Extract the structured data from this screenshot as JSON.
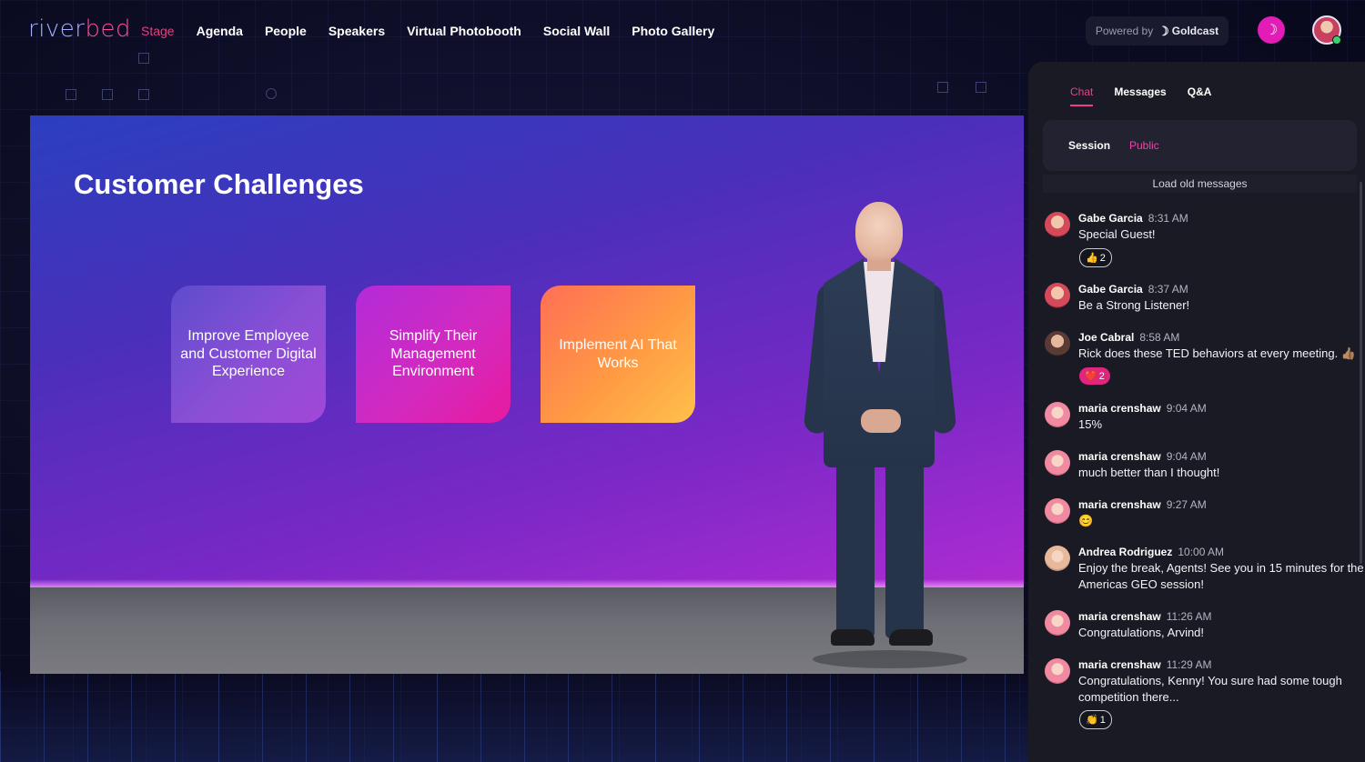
{
  "header": {
    "logo": {
      "part1": "river",
      "part2": "bed"
    },
    "nav": [
      {
        "label": "Stage",
        "active": true
      },
      {
        "label": "Agenda"
      },
      {
        "label": "People"
      },
      {
        "label": "Speakers"
      },
      {
        "label": "Virtual Photobooth"
      },
      {
        "label": "Social Wall"
      },
      {
        "label": "Photo Gallery"
      }
    ],
    "powered_by": {
      "label": "Powered by",
      "brand": "Goldcast"
    },
    "accent_color": "#e31cb7"
  },
  "stage": {
    "slide_title": "Customer Challenges",
    "cards": [
      {
        "text": "Improve Employee and Customer Digital Experience"
      },
      {
        "text": "Simplify Their Management Environment"
      },
      {
        "text": "Implement AI That Works"
      }
    ]
  },
  "chat": {
    "tabs": [
      {
        "label": "Chat",
        "active": true
      },
      {
        "label": "Messages"
      },
      {
        "label": "Q&A"
      }
    ],
    "subtabs": [
      {
        "label": "Session"
      },
      {
        "label": "Public",
        "active": true
      }
    ],
    "load_old": "Load old messages",
    "messages": [
      {
        "name": "Gabe Garcia",
        "time": "8:31 AM",
        "text": "Special Guest!",
        "reaction": {
          "emoji": "👍",
          "count": "2"
        }
      },
      {
        "name": "Gabe Garcia",
        "time": "8:37 AM",
        "text": "Be a Strong Listener!"
      },
      {
        "name": "Joe Cabral",
        "time": "8:58 AM",
        "text": "Rick does these TED behaviors at every meeting. 👍🏽",
        "reaction": {
          "emoji": "❤️",
          "count": "2"
        }
      },
      {
        "name": "maria crenshaw",
        "time": "9:04 AM",
        "text": "15%"
      },
      {
        "name": "maria crenshaw",
        "time": "9:04 AM",
        "text": "much better than I thought!"
      },
      {
        "name": "maria crenshaw",
        "time": "9:27 AM",
        "text": "😊"
      },
      {
        "name": "Andrea Rodriguez",
        "time": "10:00 AM",
        "text": "Enjoy the break, Agents! See you in 15 minutes for the Americas GEO session!"
      },
      {
        "name": "maria crenshaw",
        "time": "11:26 AM",
        "text": "Congratulations, Arvind!"
      },
      {
        "name": "maria crenshaw",
        "time": "11:29 AM",
        "text": "Congratulations, Kenny! You sure had some tough competition there...",
        "reaction": {
          "emoji": "👏",
          "count": "1"
        }
      }
    ]
  }
}
